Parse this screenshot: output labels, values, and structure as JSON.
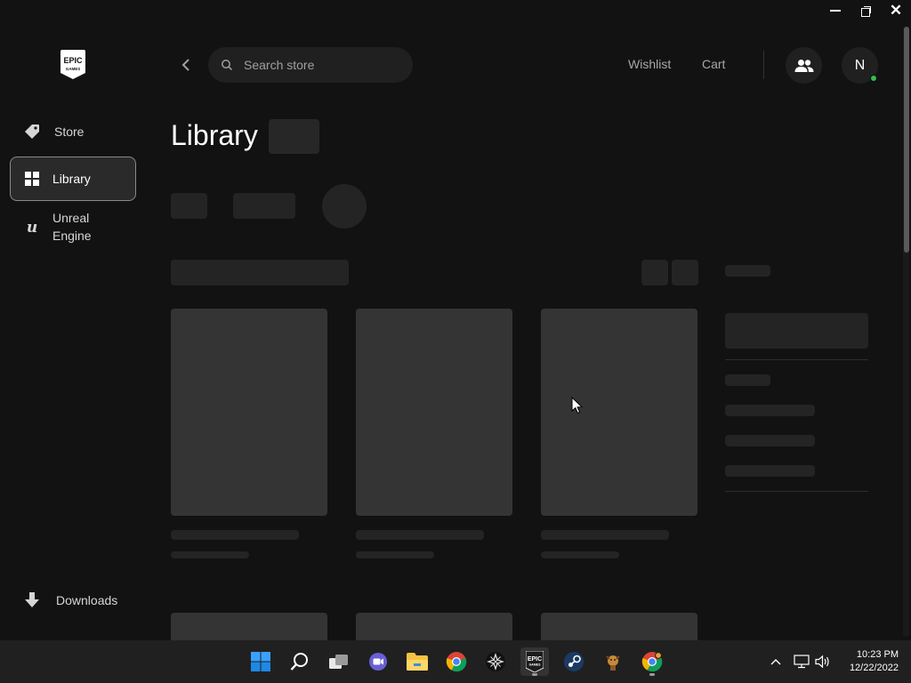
{
  "window": {
    "minimize_icon": "minimize-icon",
    "restore_icon": "restore-icon",
    "close_label": "✕"
  },
  "sidebar": {
    "logo_text_top": "EPIC",
    "logo_text_bottom": "GAMES",
    "items": [
      {
        "label": "Store",
        "icon": "tag-icon"
      },
      {
        "label": "Library",
        "icon": "grid-icon",
        "active": true
      },
      {
        "label": "Unreal Engine",
        "icon": "unreal-icon"
      }
    ],
    "downloads_label": "Downloads"
  },
  "header": {
    "search_placeholder": "Search store",
    "wishlist_label": "Wishlist",
    "cart_label": "Cart",
    "avatar_initial": "N",
    "online_color": "#2fbf4f"
  },
  "main": {
    "title": "Library"
  },
  "taskbar": {
    "apps": [
      "windows-start",
      "search",
      "task-view",
      "teams-chat",
      "file-explorer",
      "chrome",
      "pinwheel-app",
      "epic-games",
      "steam",
      "game-app",
      "chrome-profile"
    ],
    "clock_time": "10:23 PM",
    "clock_date": "12/22/2022"
  },
  "colors": {
    "background": "#121212",
    "skeleton": "#343434",
    "accent": "#ffffff"
  }
}
